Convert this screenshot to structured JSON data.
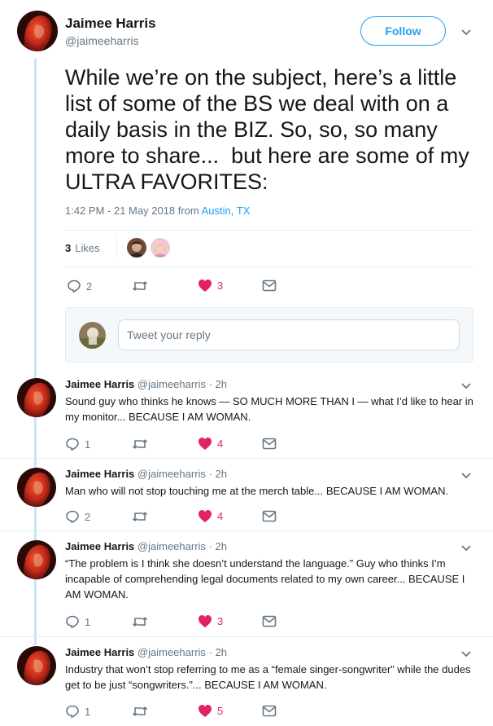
{
  "colors": {
    "accent": "#1da1f2",
    "like": "#e0245e",
    "muted": "#657786",
    "thread_line": "#c4e6f5"
  },
  "main_tweet": {
    "author_name": "Jaimee Harris",
    "author_handle": "@jaimeeharris",
    "follow_label": "Follow",
    "text": "While we’re on the subject, here’s a little list of some of the BS we deal with on a daily basis in the BIZ. So, so, so many more to share...  but here are some of my ULTRA FAVORITES:",
    "timestamp": "1:42 PM - 21 May 2018 from ",
    "location": "Austin, TX",
    "likes_count": "3",
    "likes_label": "Likes",
    "reply_count": "2",
    "retweet_count": "",
    "like_count": "3",
    "icons": [
      "reply-icon",
      "retweet-icon",
      "heart-icon",
      "message-icon",
      "chevron-down-icon"
    ]
  },
  "reply_box": {
    "placeholder": "Tweet your reply"
  },
  "replies": [
    {
      "author_name": "Jaimee Harris",
      "author_handle": "@jaimeeharris · 2h",
      "text": "Sound guy who thinks he knows — SO MUCH MORE THAN I — what I’d like to hear in my monitor... BECAUSE I AM WOMAN.",
      "reply_count": "1",
      "like_count": "4"
    },
    {
      "author_name": "Jaimee Harris",
      "author_handle": "@jaimeeharris · 2h",
      "text": "Man who will not stop touching me at the merch table... BECAUSE I AM WOMAN.",
      "reply_count": "2",
      "like_count": "4"
    },
    {
      "author_name": "Jaimee Harris",
      "author_handle": "@jaimeeharris · 2h",
      "text": "“The problem is I think she doesn’t understand the language.” Guy who thinks I’m incapable of comprehending legal documents related to my own career... BECAUSE I AM WOMAN.",
      "reply_count": "1",
      "like_count": "3"
    },
    {
      "author_name": "Jaimee Harris",
      "author_handle": "@jaimeeharris · 2h",
      "text": "Industry that won’t stop referring to me as a “female singer-songwriter” while the dudes get to be just “songwriters.”... BECAUSE I AM WOMAN.",
      "reply_count": "1",
      "like_count": "5"
    }
  ]
}
